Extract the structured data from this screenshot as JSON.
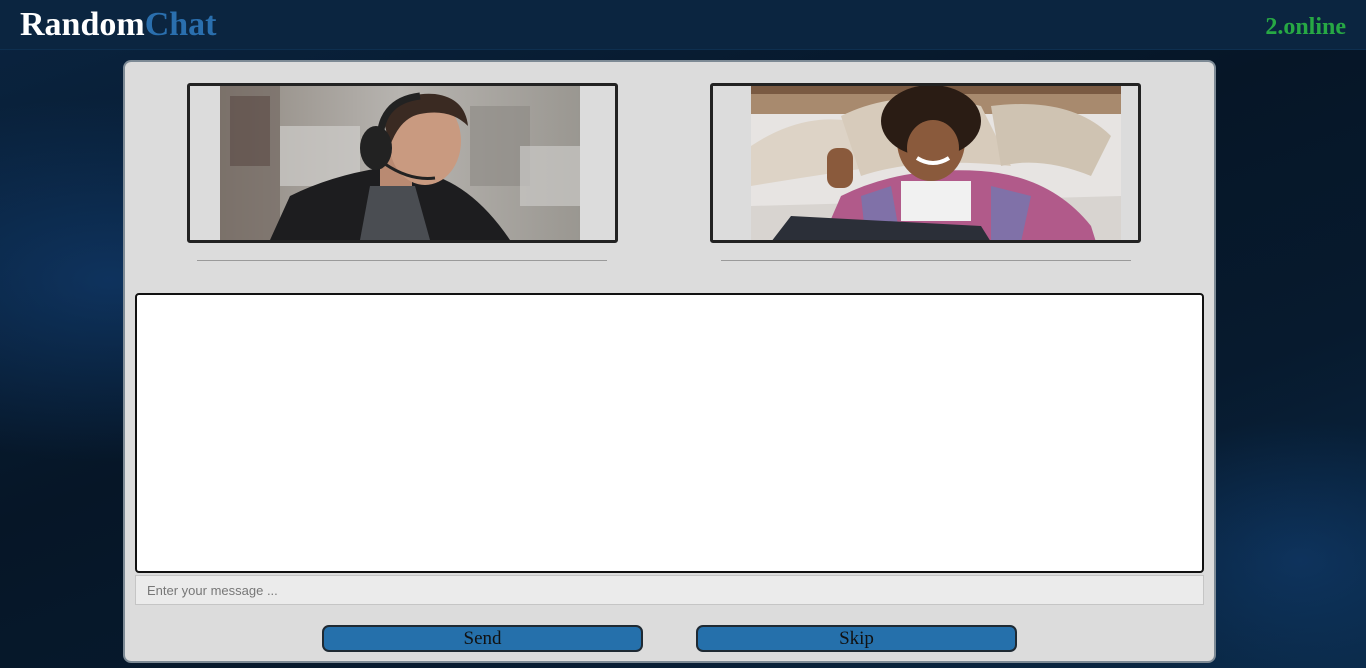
{
  "header": {
    "logo_part1": "Random",
    "logo_part2": "Chat",
    "online_count": "2.online"
  },
  "videos": {
    "local": {
      "icon": "person-with-headset-image"
    },
    "remote": {
      "icon": "person-waving-image"
    }
  },
  "chat": {
    "messages": [],
    "input_placeholder": "Enter your message ...",
    "input_value": ""
  },
  "buttons": {
    "send_label": "Send",
    "skip_label": "Skip"
  },
  "colors": {
    "brand_white": "#ffffff",
    "brand_blue": "#2a6fae",
    "online_green": "#27a844",
    "button_blue": "#2570ab",
    "panel_bg": "#dcdcdc"
  }
}
